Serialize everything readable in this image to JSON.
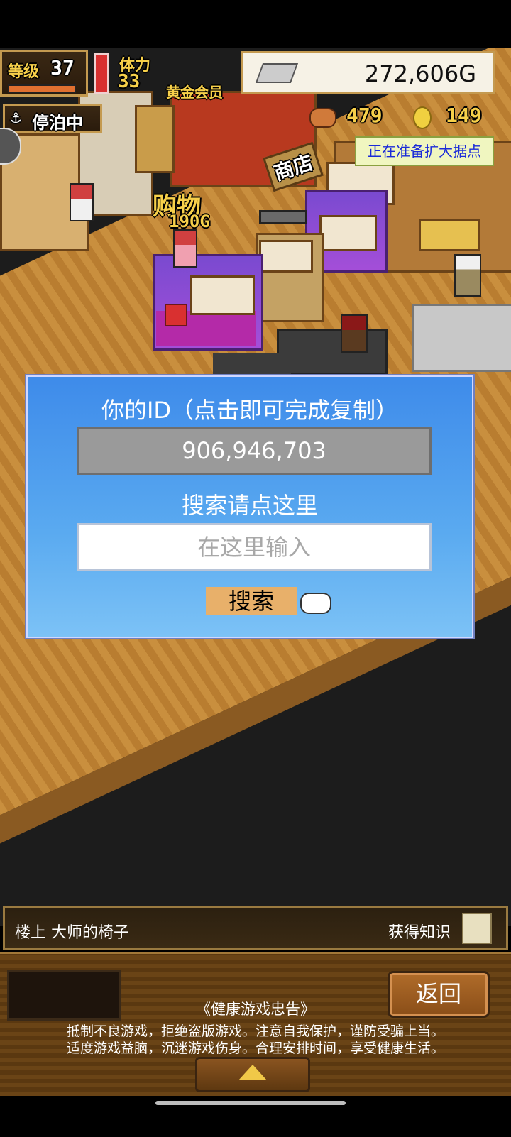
{
  "hud": {
    "level_label": "等级",
    "level_value": "37",
    "stamina_label": "体力",
    "stamina_value": "33",
    "membership": "黄金会员",
    "gold_amount": "272,606G",
    "docked_status": "停泊中",
    "item_count_a": "479",
    "item_count_b": "149",
    "expansion_notice": "正在准备扩大据点"
  },
  "scene": {
    "shopping_label": "购物",
    "shopping_price": "190G",
    "shop_sign": "商店"
  },
  "dialog": {
    "title": "你的ID（点击即可完成复制）",
    "user_id": "906,946,703",
    "search_label": "搜索请点这里",
    "search_placeholder": "在这里输入",
    "search_value": "",
    "search_button": "搜索"
  },
  "info_bar": {
    "left_text": "楼上 大师的椅子",
    "right_text": "获得知识"
  },
  "bottom": {
    "back_button": "返回",
    "notice_title": "《健康游戏忠告》",
    "notice_line1": "抵制不良游戏，拒绝盗版游戏。注意自我保护，谨防受骗上当。",
    "notice_line2": "适度游戏益脑，沉迷游戏伤身。合理安排时间，享受健康生活。"
  },
  "colors": {
    "dialog_top": "#3e8bea",
    "dialog_bottom": "#7cc2f6",
    "search_button_bg": "#e8b06a",
    "id_box_bg": "#9a9a9a"
  },
  "icons": [
    "anchor-icon",
    "meat-icon",
    "coin-icon",
    "gold-bar-icon",
    "pointing-hand-icon",
    "knowledge-icon",
    "up-arrow-icon"
  ]
}
